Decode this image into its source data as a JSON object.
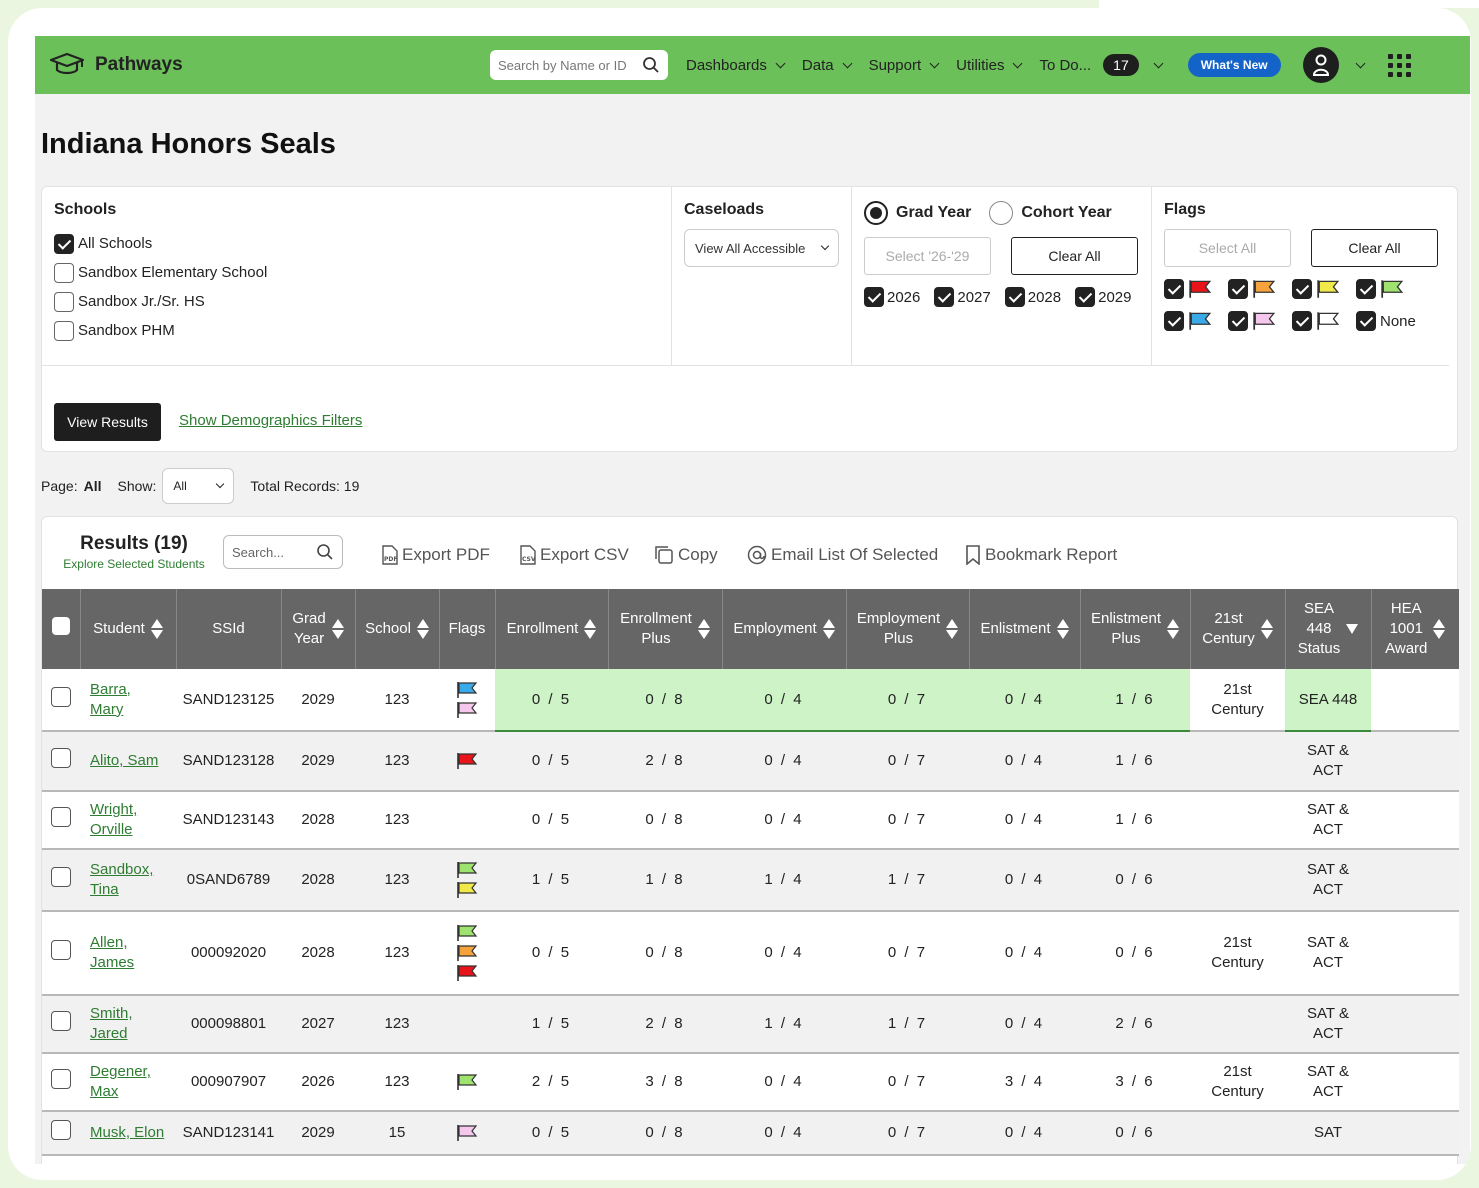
{
  "app": {
    "name": "Pathways"
  },
  "topnav": {
    "search_placeholder": "Search by Name or ID",
    "items": [
      "Dashboards",
      "Data",
      "Support",
      "Utilities"
    ],
    "todo_label": "To Do...",
    "todo_count": "17",
    "whats_new": "What's New"
  },
  "page_title": "Indiana Honors Seals",
  "filters": {
    "schools": {
      "title": "Schools",
      "items": [
        {
          "label": "All Schools",
          "checked": true
        },
        {
          "label": "Sandbox Elementary School",
          "checked": false
        },
        {
          "label": "Sandbox Jr./Sr. HS",
          "checked": false
        },
        {
          "label": "Sandbox PHM",
          "checked": false
        }
      ]
    },
    "caseloads": {
      "title": "Caseloads",
      "selected": "View All Accessible"
    },
    "year": {
      "grad_label": "Grad Year",
      "cohort_label": "Cohort Year",
      "select_placeholder": "Select '26-'29",
      "clear_all": "Clear All",
      "years": [
        "2026",
        "2027",
        "2028",
        "2029"
      ]
    },
    "flags": {
      "title": "Flags",
      "select_all": "Select All",
      "clear_all": "Clear All",
      "none_label": "None",
      "colors": [
        "#e8141a",
        "#f5a33c",
        "#f1e84a",
        "#9ee26f",
        "#3aa9e8",
        "#f5c7ec",
        "#ffffff"
      ]
    },
    "view_results": "View Results",
    "demographics_link": "Show Demographics Filters"
  },
  "pageinfo": {
    "page_label": "Page:",
    "page_value": "All",
    "show_label": "Show:",
    "show_value": "All",
    "total": "Total Records: 19"
  },
  "results": {
    "title": "Results (19)",
    "explore": "Explore Selected Students",
    "search_placeholder": "Search...",
    "tools": {
      "export_pdf": "Export PDF",
      "export_csv": "Export CSV",
      "copy": "Copy",
      "email": "Email List Of Selected",
      "bookmark": "Bookmark Report"
    },
    "columns": {
      "student": "Student",
      "ssid": "SSId",
      "grad1": "Grad",
      "grad2": "Year",
      "school": "School",
      "flags": "Flags",
      "enrollment": "Enrollment",
      "enrollment_plus1": "Enrollment",
      "enrollment_plus2": "Plus",
      "employment": "Employment",
      "employment_plus1": "Employment",
      "employment_plus2": "Plus",
      "enlistment": "Enlistment",
      "enlistment_plus1": "Enlistment",
      "enlistment_plus2": "Plus",
      "c21_1": "21st",
      "c21_2": "Century",
      "sea1": "SEA",
      "sea2": "448",
      "sea3": "Status",
      "hea1": "HEA",
      "hea2": "1001",
      "hea3": "Award"
    },
    "rows": [
      {
        "name1": "Barra,",
        "name2": "Mary",
        "ssid": "SAND123125",
        "year": "2029",
        "school": "123",
        "flags": [
          "#3aa9e8",
          "#f5c7ec"
        ],
        "enr": "0 / 5",
        "enrp": "0 / 8",
        "emp": "0 / 4",
        "empp": "0 / 7",
        "enl": "0 / 4",
        "enlp": "1 / 6",
        "c21_1": "21st",
        "c21_2": "Century",
        "sea1": "SEA 448",
        "sea2": "",
        "hea": ""
      },
      {
        "name1": "Alito, Sam",
        "name2": "",
        "ssid": "SAND123128",
        "year": "2029",
        "school": "123",
        "flags": [
          "#e8141a"
        ],
        "enr": "0 / 5",
        "enrp": "2 / 8",
        "emp": "0 / 4",
        "empp": "0 / 7",
        "enl": "0 / 4",
        "enlp": "1 / 6",
        "c21_1": "",
        "c21_2": "",
        "sea1": "SAT &",
        "sea2": "ACT",
        "hea": ""
      },
      {
        "name1": "Wright,",
        "name2": "Orville",
        "ssid": "SAND123143",
        "year": "2028",
        "school": "123",
        "flags": [],
        "enr": "0 / 5",
        "enrp": "0 / 8",
        "emp": "0 / 4",
        "empp": "0 / 7",
        "enl": "0 / 4",
        "enlp": "1 / 6",
        "c21_1": "",
        "c21_2": "",
        "sea1": "SAT &",
        "sea2": "ACT",
        "hea": ""
      },
      {
        "name1": "Sandbox,",
        "name2": "Tina",
        "ssid": "0SAND6789",
        "year": "2028",
        "school": "123",
        "flags": [
          "#9ee26f",
          "#f1e84a"
        ],
        "enr": "1 / 5",
        "enrp": "1 / 8",
        "emp": "1 / 4",
        "empp": "1 / 7",
        "enl": "0 / 4",
        "enlp": "0 / 6",
        "c21_1": "",
        "c21_2": "",
        "sea1": "SAT &",
        "sea2": "ACT",
        "hea": ""
      },
      {
        "name1": "Allen,",
        "name2": "James",
        "ssid": "000092020",
        "year": "2028",
        "school": "123",
        "flags": [
          "#9ee26f",
          "#f5a33c",
          "#e8141a"
        ],
        "enr": "0 / 5",
        "enrp": "0 / 8",
        "emp": "0 / 4",
        "empp": "0 / 7",
        "enl": "0 / 4",
        "enlp": "0 / 6",
        "c21_1": "21st",
        "c21_2": "Century",
        "sea1": "SAT &",
        "sea2": "ACT",
        "hea": ""
      },
      {
        "name1": "Smith,",
        "name2": "Jared",
        "ssid": "000098801",
        "year": "2027",
        "school": "123",
        "flags": [],
        "enr": "1 / 5",
        "enrp": "2 / 8",
        "emp": "1 / 4",
        "empp": "1 / 7",
        "enl": "0 / 4",
        "enlp": "2 / 6",
        "c21_1": "",
        "c21_2": "",
        "sea1": "SAT &",
        "sea2": "ACT",
        "hea": ""
      },
      {
        "name1": "Degener,",
        "name2": "Max",
        "ssid": "000907907",
        "year": "2026",
        "school": "123",
        "flags": [
          "#9ee26f"
        ],
        "enr": "2 / 5",
        "enrp": "3 / 8",
        "emp": "0 / 4",
        "empp": "0 / 7",
        "enl": "3 / 4",
        "enlp": "3 / 6",
        "c21_1": "21st",
        "c21_2": "Century",
        "sea1": "SAT &",
        "sea2": "ACT",
        "hea": ""
      },
      {
        "name1": "Musk, Elon",
        "name2": "",
        "ssid": "SAND123141",
        "year": "2029",
        "school": "15",
        "flags": [
          "#f5c7ec"
        ],
        "enr": "0 / 5",
        "enrp": "0 / 8",
        "emp": "0 / 4",
        "empp": "0 / 7",
        "enl": "0 / 4",
        "enlp": "0 / 6",
        "c21_1": "",
        "c21_2": "",
        "sea1": "SAT",
        "sea2": "",
        "hea": ""
      }
    ]
  }
}
